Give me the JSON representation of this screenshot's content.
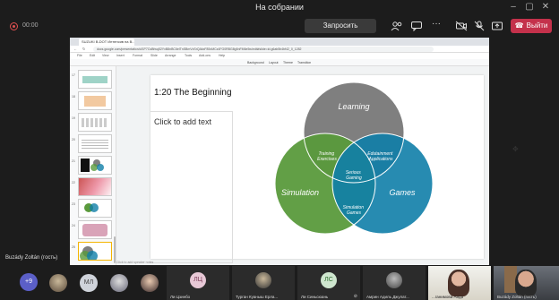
{
  "window": {
    "title": "На собрании"
  },
  "toolbar": {
    "rec_time": "00:00",
    "request_control": "Запросить управление",
    "leave": "Выйти"
  },
  "browser": {
    "tab_title": "SUZUKI B-DOT Интенсив на B...",
    "address": "docs.google.com/presentation/d/1P7CsBfwq52YxB8nBC6elTnSBmVxSrQAkxF85xMCz4FG0RBG8g5nFM6e5w/edit#slide=id.g6ab5b4bf42_0_1282"
  },
  "slides_menu": [
    "File",
    "Edit",
    "View",
    "Insert",
    "Format",
    "Slide",
    "Arrange",
    "Tools",
    "Add-ons",
    "Help"
  ],
  "slides_toolbar": [
    "Background",
    "Layout",
    "Theme",
    "Transition"
  ],
  "filmstrip": {
    "numbers": [
      "17",
      "18",
      "19",
      "20",
      "21",
      "22",
      "23",
      "24",
      "25"
    ],
    "last_thumb_text": "How to inspire your own Tree of work?"
  },
  "slide": {
    "title": "1:20 The Beginning",
    "body_placeholder": "Click to add text",
    "notes_placeholder": "Click to add speaker notes"
  },
  "venn": {
    "circles": [
      {
        "label": "Learning",
        "color": "#7f7f7f"
      },
      {
        "label": "Simulation",
        "color": "#5a9a3c"
      },
      {
        "label": "Games",
        "color": "#0f7ea8"
      }
    ],
    "overlaps": {
      "learning_simulation": "Training Exercises",
      "learning_games": "Edutainment Applications",
      "simulation_games": "Simulation Games",
      "center": "Serious Gaming"
    }
  },
  "presenter": {
    "name": "Buzády Zoltán (гость)"
  },
  "participants": {
    "more_count": "+9",
    "tiles": [
      {
        "initials": "МЛ",
        "name": ""
      },
      {
        "initials": "ЛЦ",
        "name": "Ли Цзинбо"
      },
      {
        "initials": "",
        "name": "Турган Куаныш Ерла..."
      },
      {
        "initials": "ЛС",
        "name": "Ли Синьсюань"
      },
      {
        "initials": "",
        "name": "Амрин Адиль Джулат..."
      },
      {
        "initials": "",
        "name": "...ганимова Аида"
      },
      {
        "initials": "",
        "name": "Buzády Zoltán (гость)"
      }
    ]
  }
}
